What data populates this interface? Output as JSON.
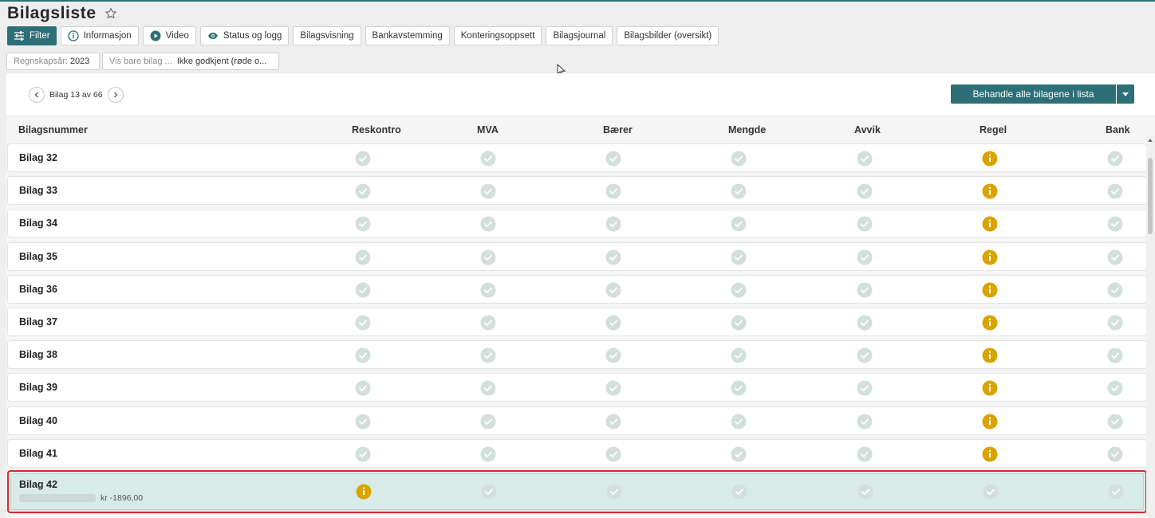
{
  "header": {
    "title": "Bilagsliste"
  },
  "toolbar": {
    "filter": "Filter",
    "informasjon": "Informasjon",
    "video": "Video",
    "status_log": "Status og logg",
    "bilagsvisning": "Bilagsvisning",
    "bankavstemming": "Bankavstemming",
    "konteringsoppsett": "Konteringsoppsett",
    "bilagsjournal": "Bilagsjournal",
    "bilagsbilder": "Bilagsbilder (oversikt)"
  },
  "filters": {
    "year_label": "Regnskapsår:",
    "year_value": "2023",
    "show_label": "Vis bare bilag ...",
    "show_value": "Ikke godkjent (røde o..."
  },
  "pager": {
    "text": "Bilag 13 av 66"
  },
  "bulk": {
    "label": "Behandle alle bilagene i lista"
  },
  "columns": {
    "bilagsnummer": "Bilagsnummer",
    "reskontro": "Reskontro",
    "mva": "MVA",
    "baerer": "Bærer",
    "mengde": "Mengde",
    "avvik": "Avvik",
    "regel": "Regel",
    "bank": "Bank"
  },
  "status_colors": {
    "ok": "#d3dfdd",
    "warning": "#d9a400",
    "accent": "#2d6f76",
    "selected_border": "#d92b2b"
  },
  "rows": [
    {
      "name": "Bilag 32",
      "statuses": [
        "ok",
        "ok",
        "ok",
        "ok",
        "ok",
        "warning",
        "ok"
      ]
    },
    {
      "name": "Bilag 33",
      "statuses": [
        "ok",
        "ok",
        "ok",
        "ok",
        "ok",
        "warning",
        "ok"
      ]
    },
    {
      "name": "Bilag 34",
      "statuses": [
        "ok",
        "ok",
        "ok",
        "ok",
        "ok",
        "warning",
        "ok"
      ]
    },
    {
      "name": "Bilag 35",
      "statuses": [
        "ok",
        "ok",
        "ok",
        "ok",
        "ok",
        "warning",
        "ok"
      ]
    },
    {
      "name": "Bilag 36",
      "statuses": [
        "ok",
        "ok",
        "ok",
        "ok",
        "ok",
        "warning",
        "ok"
      ]
    },
    {
      "name": "Bilag 37",
      "statuses": [
        "ok",
        "ok",
        "ok",
        "ok",
        "ok",
        "warning",
        "ok"
      ]
    },
    {
      "name": "Bilag 38",
      "statuses": [
        "ok",
        "ok",
        "ok",
        "ok",
        "ok",
        "warning",
        "ok"
      ]
    },
    {
      "name": "Bilag 39",
      "statuses": [
        "ok",
        "ok",
        "ok",
        "ok",
        "ok",
        "warning",
        "ok"
      ]
    },
    {
      "name": "Bilag 40",
      "statuses": [
        "ok",
        "ok",
        "ok",
        "ok",
        "ok",
        "warning",
        "ok"
      ]
    },
    {
      "name": "Bilag 41",
      "statuses": [
        "ok",
        "ok",
        "ok",
        "ok",
        "ok",
        "warning",
        "ok"
      ]
    },
    {
      "name": "Bilag 42",
      "amount": "kr -1896,00",
      "selected": true,
      "statuses": [
        "warning",
        "ok",
        "ok",
        "ok",
        "ok",
        "ok",
        "ok"
      ]
    }
  ]
}
